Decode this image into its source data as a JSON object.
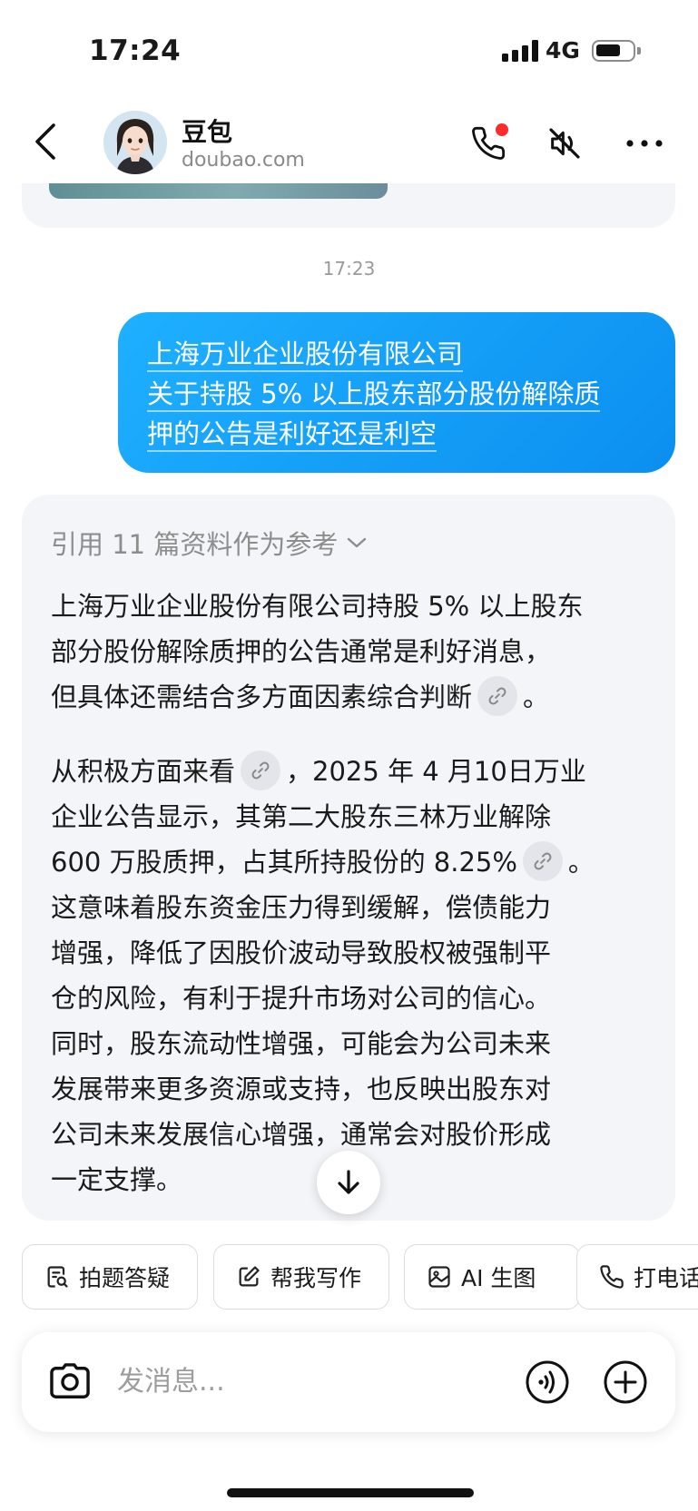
{
  "status_bar": {
    "time": "17:24",
    "network": "4G"
  },
  "header": {
    "name": "豆包",
    "subtitle": "doubao.com"
  },
  "chat": {
    "timestamp": "17:23",
    "user_message_lines": [
      "上海万业企业股份有限公司",
      "关于持股 5% 以上股东部分股份解除质",
      "押的公告是利好还是利空"
    ],
    "reply": {
      "references_label": "引用 11 篇资料作为参考",
      "para1": {
        "line1": "上海万业企业股份有限公司持股 5% 以上股东",
        "line2": "部分股份解除质押的公告通常是利好消息，",
        "line3": "但具体还需结合多方面因素综合判断",
        "line3_end": "。"
      },
      "para2": {
        "line1_start": "从积极方面来看",
        "line1_end": "，2025 年 4 月10日万业",
        "line2": "企业公告显示，其第二大股东三林万业解除",
        "line3_start": " 600 万股质押，占其所持股份的 8.25%",
        "line3_end": "。",
        "line4": "这意味着股东资金压力得到缓解，偿债能力",
        "line5": "增强，降低了因股价波动导致股权被强制平",
        "line6": "仓的风险，有利于提升市场对公司的信心。",
        "line7": "同时，股东流动性增强，可能会为公司未来",
        "line8": "发展带来更多资源或支持，也反映出股东对",
        "line9": "公司未来发展信心增强，通常会对股价形成",
        "line10": "一定支撑。"
      }
    }
  },
  "quick_actions": [
    "拍题答疑",
    "帮我写作",
    "AI 生图",
    "打电话"
  ],
  "input": {
    "placeholder": "发消息..."
  }
}
